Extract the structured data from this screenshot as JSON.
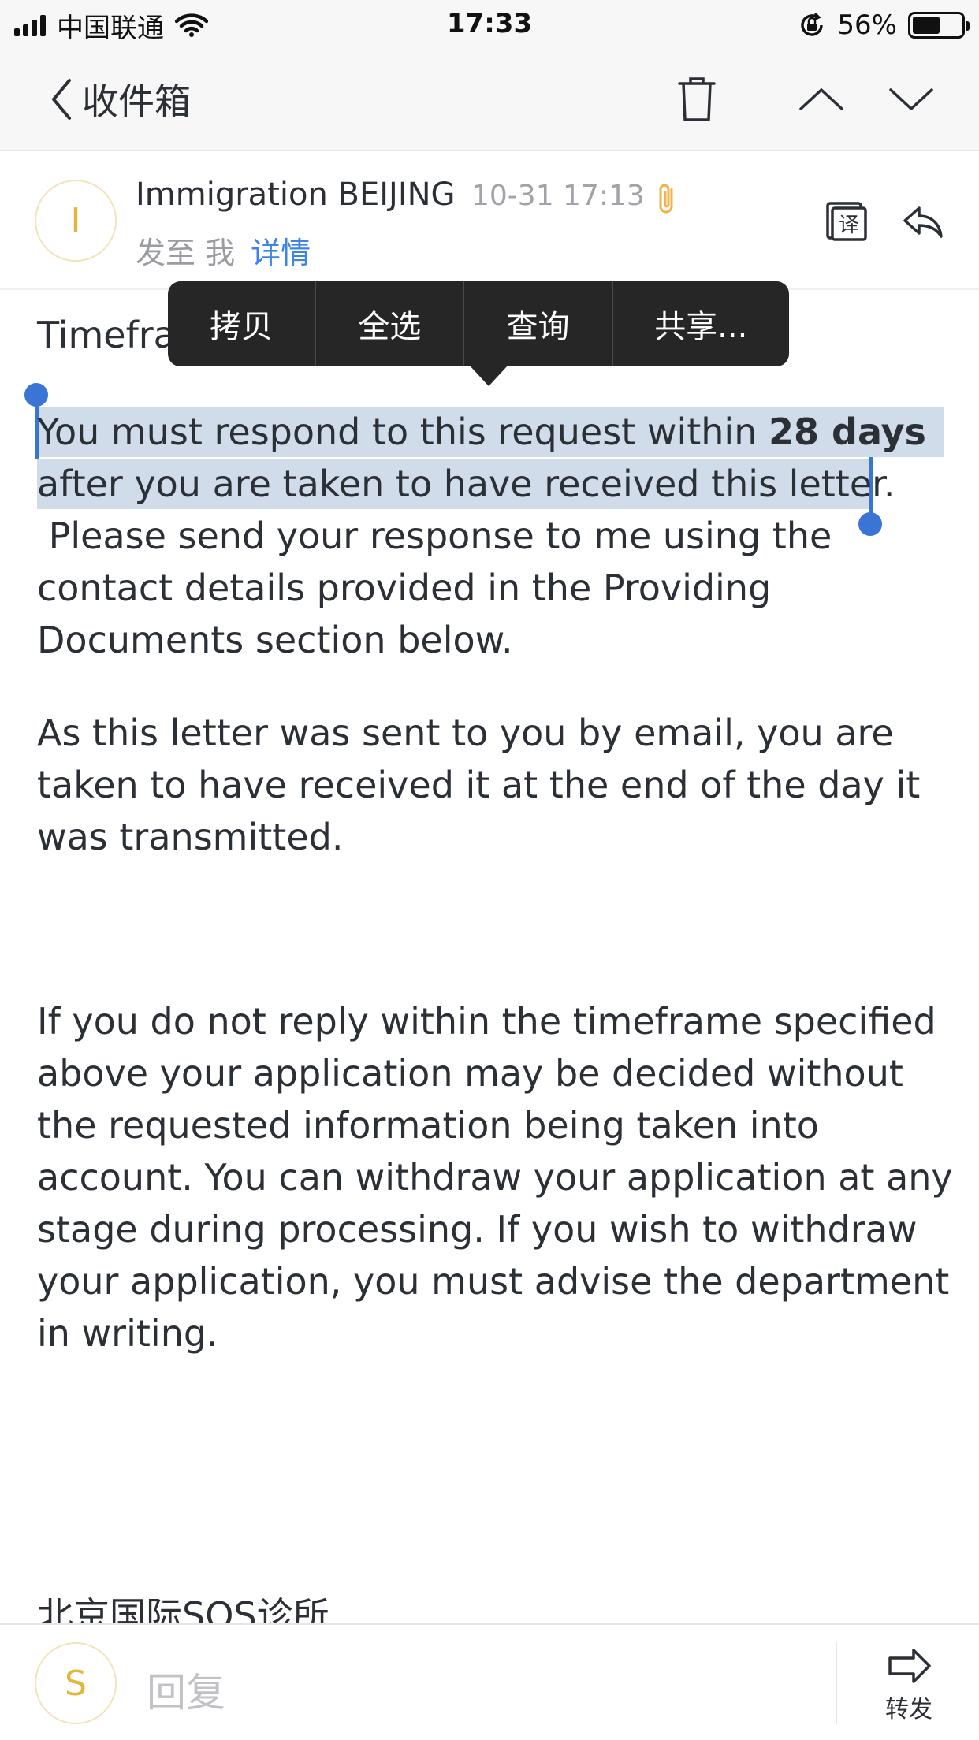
{
  "status_bar": {
    "carrier": "中国联通",
    "time": "17:33",
    "battery_percent": "56%",
    "battery_level": 0.56
  },
  "nav": {
    "back_label": "收件箱",
    "icons": [
      "chevron-left-icon",
      "trash-icon",
      "chevron-up-icon",
      "chevron-down-icon"
    ]
  },
  "header": {
    "avatar_letter": "I",
    "sender": "Immigration BEIJING",
    "time": "10-31 17:13",
    "to_label": "发至 我",
    "details_link": "详情",
    "icons": [
      "translate-icon",
      "reply-icon",
      "attachment-icon"
    ]
  },
  "context_menu": {
    "items": [
      "拷贝",
      "全选",
      "查询",
      "共享..."
    ]
  },
  "body": {
    "heading_partial": "Timefra",
    "selected_line1_pre": "You must respond to this request within ",
    "selected_line1_bold": "28 days",
    "selected_line2": "after you are taken to have received this letter.",
    "p1_rest": " Please send your response to me using the contact details provided in the Providing Documents section below.",
    "p2": "As this letter was sent to you by email, you are taken to have received it at the end of the day it was transmitted.",
    "p3": "If you do not reply within the timeframe specified above your application may be decided without the requested information being taken into account. You can withdraw your application at any stage during processing. If you wish to withdraw your application, you must advise the department in writing.",
    "signature_partial": "北京国际SOS诊所"
  },
  "bottom_bar": {
    "avatar_letter": "S",
    "reply_placeholder": "回复",
    "forward_label": "转发"
  },
  "colors": {
    "accent": "#3d84e6",
    "selection": "#d0dcea",
    "handle": "#3a75d6",
    "avatar_text": "#e3b63c",
    "attachment": "#f0b24a"
  }
}
